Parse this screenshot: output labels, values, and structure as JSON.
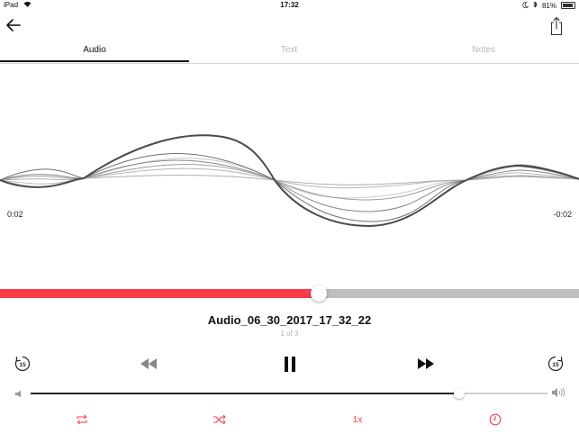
{
  "status_bar": {
    "device": "iPad",
    "time": "17:32",
    "battery": "81%",
    "wifi_icon": "wifi-icon",
    "moon_icon": "moon-icon",
    "bluetooth_icon": "bluetooth-icon"
  },
  "nav": {
    "back_icon": "arrow-left-icon",
    "share_icon": "share-icon"
  },
  "tabs": [
    {
      "label": "Audio",
      "active": true
    },
    {
      "label": "Text",
      "active": false
    },
    {
      "label": "Notes",
      "active": false
    }
  ],
  "player": {
    "elapsed": "0:02",
    "remaining": "-0:02",
    "progress_fraction": 0.55,
    "title": "Audio_06_30_2017_17_32_22",
    "count": "1 of 3"
  },
  "controls": {
    "skip_back": {
      "icon": "skip-back-15-icon",
      "label": "15"
    },
    "rewind_icon": "rewind-icon",
    "pause_icon": "pause-icon",
    "fast_forward_icon": "fast-forward-icon",
    "skip_forward": {
      "icon": "skip-forward-15-icon",
      "label": "15"
    }
  },
  "volume": {
    "level_fraction": 0.83,
    "low_icon": "volume-low-icon",
    "high_icon": "volume-high-icon"
  },
  "options": {
    "repeat_icon": "repeat-icon",
    "shuffle_icon": "shuffle-icon",
    "speed": "1x",
    "timer_icon": "timer-icon"
  },
  "colors": {
    "accent": "#fc3d49",
    "track": "#bfbfbf",
    "text": "#111111",
    "muted": "#b7b7b7"
  }
}
